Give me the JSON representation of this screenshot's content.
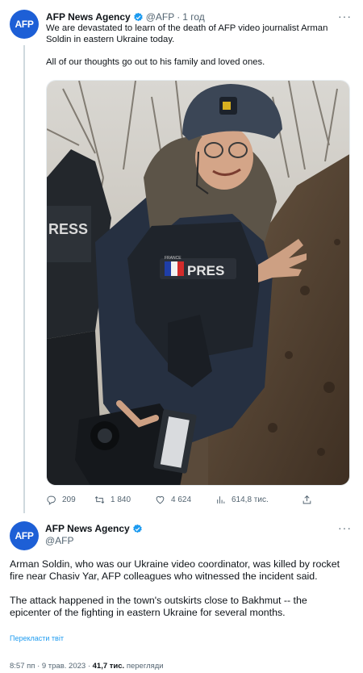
{
  "tweet1": {
    "author_name": "AFP News Agency",
    "handle": "@AFP",
    "separator": "·",
    "time": "1 год",
    "avatar_text": "AFP",
    "text_p1": "We are devastated to learn of the death of AFP video journalist Arman Soldin in eastern Ukraine today.",
    "text_p2": "All of our thoughts go out to his family and loved ones.",
    "photo": {
      "vest_label_left": "RESS",
      "vest_label_main": "PRES",
      "flag_label": "FRANCE"
    },
    "actions": {
      "replies": "209",
      "retweets": "1 840",
      "likes": "4 624",
      "views": "614,8 тис."
    },
    "more_icon": "more-dots-icon"
  },
  "tweet2": {
    "author_name": "AFP News Agency",
    "handle": "@AFP",
    "avatar_text": "AFP",
    "text_p1": "Arman Soldin, who was our Ukraine video coordinator, was killed by rocket fire near Chasiv Yar, AFP colleagues who witnessed the incident said.",
    "text_p2": "The attack happened in the town's outskirts close to Bakhmut -- the epicenter of the fighting in eastern Ukraine for several months.",
    "translate_label": "Перекласти твіт",
    "time": "8:57 пп",
    "date": "9 трав. 2023",
    "views_count": "41,7 тис.",
    "views_label": "перегляди",
    "separator": "·"
  },
  "colors": {
    "brand": "#1d5fd6",
    "verified": "#1d9bf0",
    "muted": "#536471",
    "link": "#1d9bf0"
  }
}
